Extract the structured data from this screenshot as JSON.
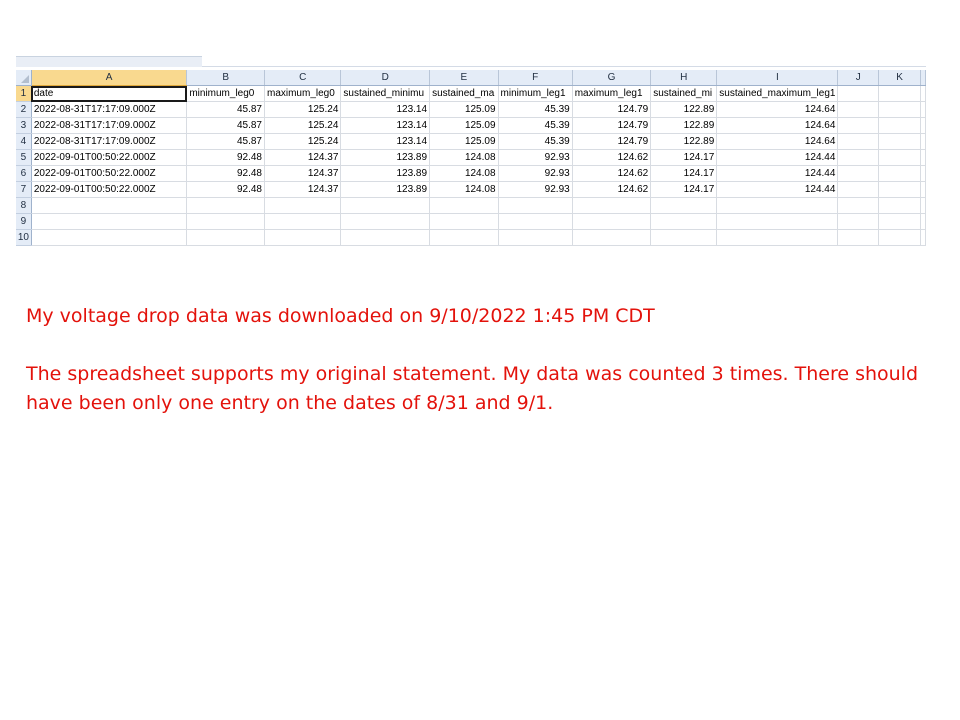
{
  "spreadsheet": {
    "columns": [
      "A",
      "B",
      "C",
      "D",
      "E",
      "F",
      "G",
      "H",
      "I",
      "J",
      "K"
    ],
    "active_column": "A",
    "active_row": "1",
    "rows": [
      {
        "num": "1",
        "cells": [
          "date",
          "minimum_leg0",
          "maximum_leg0",
          "sustained_minimu",
          "sustained_ma",
          "minimum_leg1",
          "maximum_leg1",
          "sustained_mi",
          "sustained_maximum_leg1",
          "",
          ""
        ]
      },
      {
        "num": "2",
        "cells": [
          "2022-08-31T17:17:09.000Z",
          "45.87",
          "125.24",
          "123.14",
          "125.09",
          "45.39",
          "124.79",
          "122.89",
          "124.64",
          "",
          ""
        ]
      },
      {
        "num": "3",
        "cells": [
          "2022-08-31T17:17:09.000Z",
          "45.87",
          "125.24",
          "123.14",
          "125.09",
          "45.39",
          "124.79",
          "122.89",
          "124.64",
          "",
          ""
        ]
      },
      {
        "num": "4",
        "cells": [
          "2022-08-31T17:17:09.000Z",
          "45.87",
          "125.24",
          "123.14",
          "125.09",
          "45.39",
          "124.79",
          "122.89",
          "124.64",
          "",
          ""
        ]
      },
      {
        "num": "5",
        "cells": [
          "2022-09-01T00:50:22.000Z",
          "92.48",
          "124.37",
          "123.89",
          "124.08",
          "92.93",
          "124.62",
          "124.17",
          "124.44",
          "",
          ""
        ]
      },
      {
        "num": "6",
        "cells": [
          "2022-09-01T00:50:22.000Z",
          "92.48",
          "124.37",
          "123.89",
          "124.08",
          "92.93",
          "124.62",
          "124.17",
          "124.44",
          "",
          ""
        ]
      },
      {
        "num": "7",
        "cells": [
          "2022-09-01T00:50:22.000Z",
          "92.48",
          "124.37",
          "123.89",
          "124.08",
          "92.93",
          "124.62",
          "124.17",
          "124.44",
          "",
          ""
        ]
      },
      {
        "num": "8",
        "cells": [
          "",
          "",
          "",
          "",
          "",
          "",
          "",
          "",
          "",
          "",
          ""
        ]
      },
      {
        "num": "9",
        "cells": [
          "",
          "",
          "",
          "",
          "",
          "",
          "",
          "",
          "",
          "",
          ""
        ]
      },
      {
        "num": "10",
        "cells": [
          "",
          "",
          "",
          "",
          "",
          "",
          "",
          "",
          "",
          "",
          ""
        ]
      }
    ]
  },
  "notes": {
    "line1": "My voltage drop data was downloaded on 9/10/2022  1:45 PM CDT",
    "line2": "The spreadsheet supports my original statement.  My data was counted 3 times.  There should have been only one entry on the dates of 8/31 and 9/1."
  },
  "colors": {
    "note_text": "#e3120b",
    "header_bg": "#e4ecf7",
    "active_header_bg": "#f9d98f"
  }
}
